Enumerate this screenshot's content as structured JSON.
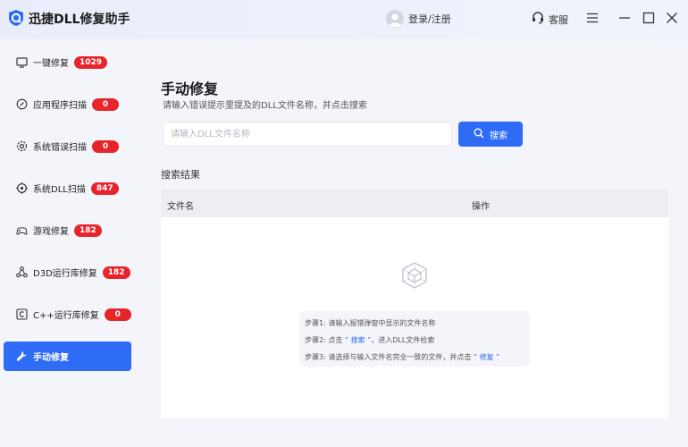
{
  "app": {
    "title": "迅捷DLL修复助手",
    "login_label": "登录/注册",
    "service_label": "客服"
  },
  "colors": {
    "accent": "#2f6cf6",
    "badge": "#e8242b",
    "background": "#f3f5fb"
  },
  "sidebar": {
    "items": [
      {
        "label": "一键修复",
        "badge": "1029",
        "icon": "wrench-tablet-icon"
      },
      {
        "label": "应用程序扫描",
        "badge": "0",
        "icon": "link-icon"
      },
      {
        "label": "系统错误扫描",
        "badge": "0",
        "icon": "gear-icon"
      },
      {
        "label": "系统DLL扫描",
        "badge": "847",
        "icon": "target-icon"
      },
      {
        "label": "游戏修复",
        "badge": "182",
        "icon": "gamepad-icon"
      },
      {
        "label": "D3D运行库修复",
        "badge": "182",
        "icon": "network-icon"
      },
      {
        "label": "C++运行库修复",
        "badge": "0",
        "icon": "c-box-icon"
      },
      {
        "label": "手动修复",
        "icon": "wrench-icon"
      }
    ]
  },
  "main": {
    "title": "手动修复",
    "subtitle": "请输入错误提示里提及的DLL文件名称，并点击搜索",
    "search": {
      "placeholder": "请输入DLL文件名称",
      "value": "",
      "button_label": "搜索"
    },
    "results_label": "搜索结果",
    "table": {
      "columns": [
        "文件名",
        "操作"
      ]
    },
    "steps": {
      "step1": "步骤1: 请输入报错弹窗中显示的文件名称",
      "step2_prefix": "步骤2: 点击",
      "step2_keyword": "“ 搜索 ”",
      "step2_suffix": "，进入DLL文件检索",
      "step3_prefix": "步骤3: 请选择与输入文件名完全一致的文件，并点击",
      "step3_keyword": "“ 修复 ”"
    }
  }
}
